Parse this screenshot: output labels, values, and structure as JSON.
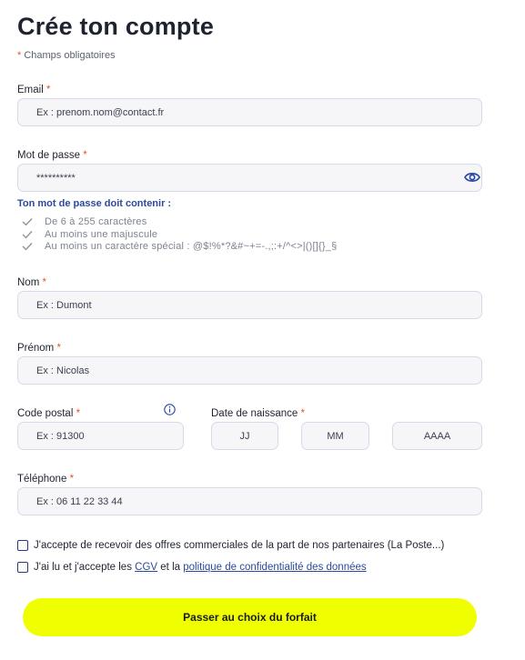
{
  "page": {
    "title": "Crée ton compte",
    "required_note": "Champs obligatoires",
    "required_mark": "*"
  },
  "email": {
    "label": "Email",
    "placeholder": "Ex : prenom.nom@contact.fr"
  },
  "password": {
    "label": "Mot de passe",
    "value": "**********",
    "rules_title": "Ton mot de passe doit contenir :",
    "rules": [
      "De 6 à 255 caractères",
      "Au moins une majuscule",
      "Au moins un caractère spécial : @$!%*?&#~+=-.,;:+/^<>|()[]{}_§"
    ]
  },
  "nom": {
    "label": "Nom",
    "placeholder": "Ex : Dumont"
  },
  "prenom": {
    "label": "Prénom",
    "placeholder": "Ex : Nicolas"
  },
  "code_postal": {
    "label": "Code postal",
    "placeholder": "Ex : 91300"
  },
  "date_naissance": {
    "label": "Date de naissance",
    "jj": "JJ",
    "mm": "MM",
    "aaaa": "AAAA"
  },
  "telephone": {
    "label": "Téléphone",
    "placeholder": "Ex : 06 11 22 33 44"
  },
  "consents": {
    "offers": "J'accepte de recevoir des offres commerciales de la part de nos partenaires (La Poste...)",
    "cgv_prefix": "J'ai lu et j'accepte les",
    "cgv_link": "CGV",
    "cgv_middle": "et la",
    "privacy_link": "politique de confidentialité des données"
  },
  "cta": {
    "label": "Passer au choix du forfait",
    "color": "#f0ff00"
  },
  "icons": {
    "password_toggle": "eye-icon",
    "postal_info": "info-icon",
    "rule_check": "check-icon"
  },
  "colors": {
    "accent": "#2b4aa0",
    "required": "#e3542b",
    "field_bg": "#f6f6f9"
  }
}
